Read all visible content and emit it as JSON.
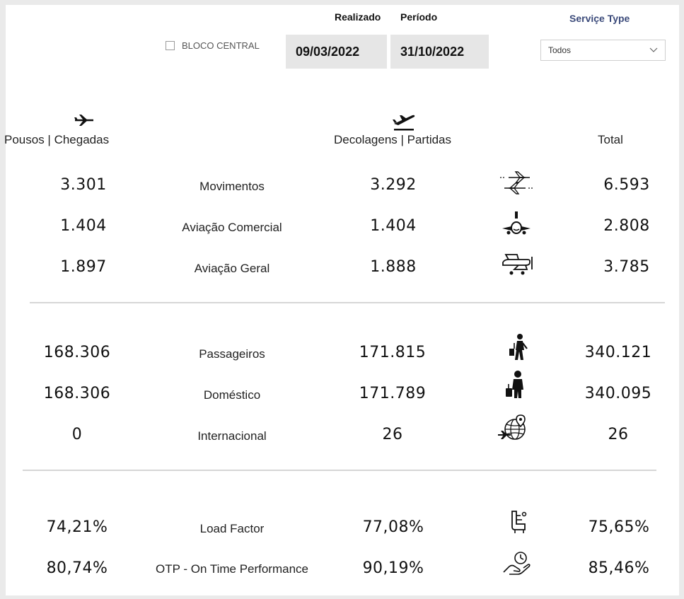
{
  "header": {
    "checkbox_label": "BLOCO CENTRAL",
    "realizado_label": "Realizado",
    "periodo_label": "Período",
    "date_start": "09/03/2022",
    "date_end": "31/10/2022",
    "service_type_title": "Serviçe Type",
    "service_type_value": "Todos"
  },
  "columns": {
    "arrivals": "Pousos | Chegadas",
    "departures": "Decolagens | Partidas",
    "total": "Total"
  },
  "rows": [
    {
      "label": "Movimentos",
      "arrivals": "3.301",
      "departures": "3.292",
      "total": "6.593",
      "icon": "movements-icon"
    },
    {
      "label": "Aviação Comercial",
      "arrivals": "1.404",
      "departures": "1.404",
      "total": "2.808",
      "icon": "commercial-aircraft-icon"
    },
    {
      "label": "Aviação Geral",
      "arrivals": "1.897",
      "departures": "1.888",
      "total": "3.785",
      "icon": "small-plane-icon"
    },
    {
      "label": "Passageiros",
      "arrivals": "168.306",
      "departures": "171.815",
      "total": "340.121",
      "icon": "traveler-icon"
    },
    {
      "label": "Doméstico",
      "arrivals": "168.306",
      "departures": "171.789",
      "total": "340.095",
      "icon": "domestic-passenger-icon"
    },
    {
      "label": "Internacional",
      "arrivals": "0",
      "departures": "26",
      "total": "26",
      "icon": "globe-plane-icon"
    },
    {
      "label": "Load Factor",
      "arrivals": "74,21%",
      "departures": "77,08%",
      "total": "75,65%",
      "icon": "seat-icon"
    },
    {
      "label": "OTP - On Time Performance",
      "arrivals": "80,74%",
      "departures": "90,19%",
      "total": "85,46%",
      "icon": "hand-clock-icon"
    }
  ]
}
